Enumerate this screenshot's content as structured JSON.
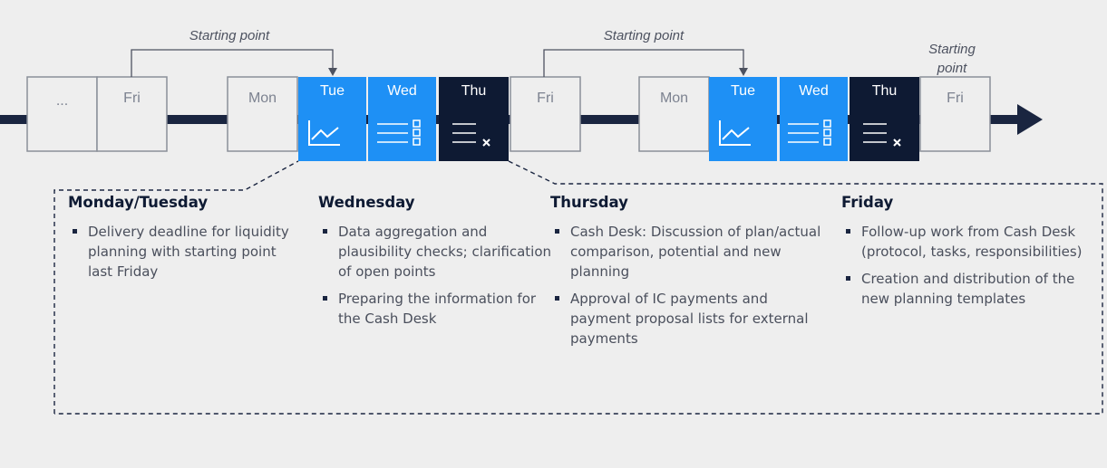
{
  "timeline": {
    "boxes": [
      {
        "id": "ellipsis-1",
        "label": "...",
        "style": "light"
      },
      {
        "id": "fri-1",
        "label": "Fri",
        "style": "light"
      },
      {
        "id": "mon-1",
        "label": "Mon",
        "style": "light"
      },
      {
        "id": "tue-1",
        "label": "Tue",
        "style": "blue",
        "icon": "line-chart-icon"
      },
      {
        "id": "wed-1",
        "label": "Wed",
        "style": "blue",
        "icon": "checklist-icon"
      },
      {
        "id": "thu-1",
        "label": "Thu",
        "style": "navy",
        "icon": "list-x-icon"
      },
      {
        "id": "fri-2",
        "label": "Fri",
        "style": "light"
      },
      {
        "id": "mon-2",
        "label": "Mon",
        "style": "light"
      },
      {
        "id": "tue-2",
        "label": "Tue",
        "style": "blue",
        "icon": "line-chart-icon"
      },
      {
        "id": "wed-2",
        "label": "Wed",
        "style": "blue",
        "icon": "checklist-icon"
      },
      {
        "id": "thu-2",
        "label": "Thu",
        "style": "navy",
        "icon": "list-x-icon"
      },
      {
        "id": "fri-3",
        "label": "Fri",
        "style": "light"
      }
    ],
    "starting_point_1": "Starting point",
    "starting_point_2": "Starting point",
    "starting_point_3_line1": "Starting",
    "starting_point_3_line2": "point"
  },
  "columns": [
    {
      "title": "Monday/Tuesday",
      "bullets": [
        "Delivery deadline for liquidity planning with starting point last Friday"
      ]
    },
    {
      "title": "Wednesday",
      "bullets": [
        "Data aggregation and plausibility checks; clarification of open points",
        "Preparing the information for the Cash Desk"
      ]
    },
    {
      "title": "Thursday",
      "bullets": [
        "Cash Desk: Discussion of plan/actual comparison, potential and new planning",
        "Approval of IC payments and payment proposal lists for external payments"
      ]
    },
    {
      "title": "Friday",
      "bullets": [
        "Follow-up work from Cash Desk (protocol, tasks, responsibilities)",
        "Creation and distribution of the new planning templates"
      ]
    }
  ],
  "colors": {
    "blue": "#1e90f5",
    "navy": "#0e1a33",
    "box_fill": "#eeeeee",
    "box_stroke": "#8a8f99",
    "line": "#1a2540"
  }
}
